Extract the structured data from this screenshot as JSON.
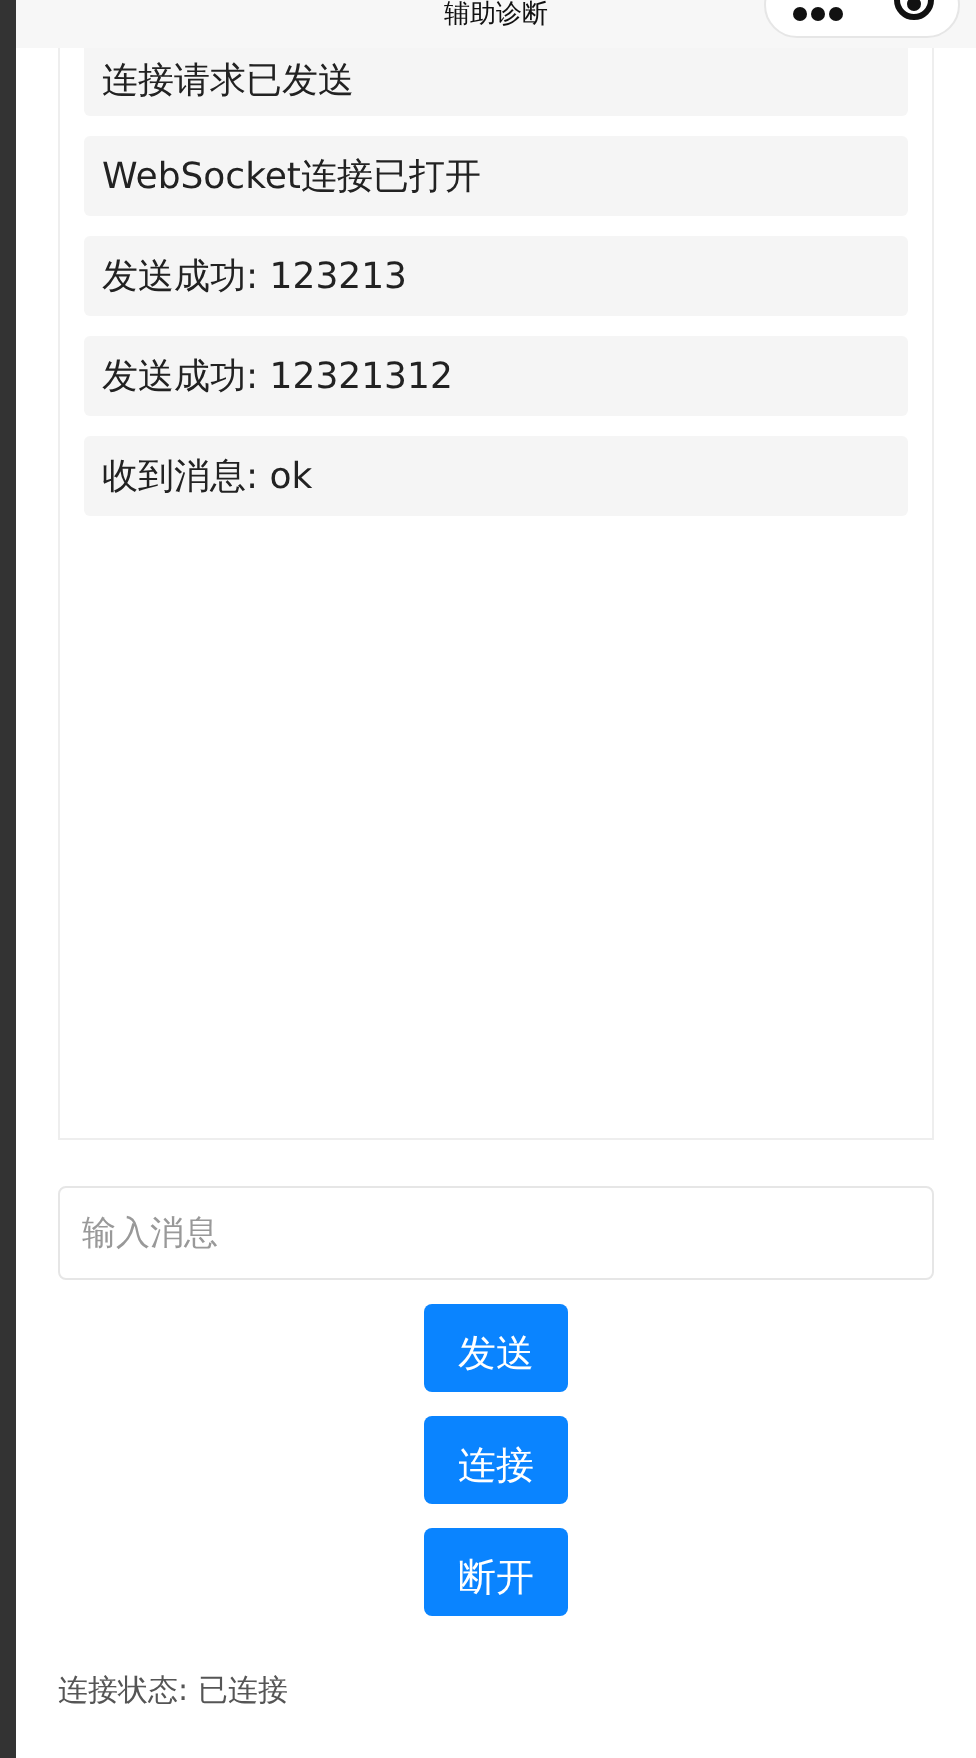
{
  "header": {
    "title": "辅助诊断"
  },
  "messages": [
    "连接请求已发送",
    "WebSocket连接已打开",
    "发送成功: 123213",
    "发送成功: 12321312",
    "收到消息: ok"
  ],
  "input": {
    "placeholder": "输入消息"
  },
  "buttons": [
    "发送",
    "连接",
    "断开"
  ],
  "status": "连接状态: 已连接"
}
